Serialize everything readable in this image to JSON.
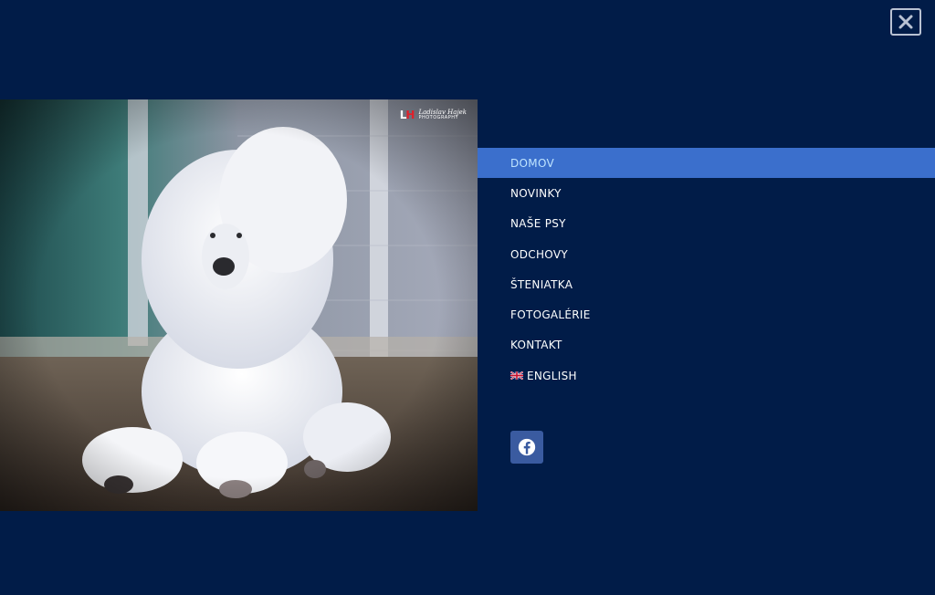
{
  "close": {
    "icon": "close-icon"
  },
  "photo": {
    "watermark_l": "L",
    "watermark_h": "H",
    "watermark_signature": "Ladislav Hajek",
    "watermark_sub": "PHOTOGRAPHY"
  },
  "nav": {
    "items": [
      {
        "label": "DOMOV",
        "active": true
      },
      {
        "label": "NOVINKY"
      },
      {
        "label": "NAŠE PSY"
      },
      {
        "label": "ODCHOVY"
      },
      {
        "label": "ŠTENIATKA"
      },
      {
        "label": "FOTOGALÉRIE"
      },
      {
        "label": "KONTAKT"
      },
      {
        "label": "ENGLISH",
        "icon": "uk-flag-icon"
      }
    ]
  },
  "social": {
    "icon": "facebook-icon"
  },
  "colors": {
    "background": "#011c48",
    "active_item": "#3b6fcc",
    "facebook": "#3a5ba0"
  }
}
